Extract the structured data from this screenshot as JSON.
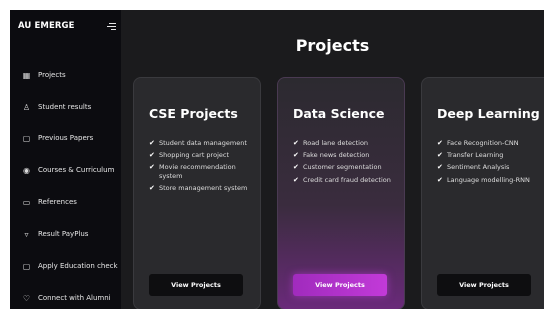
{
  "sidebar": {
    "brand": "AU EMERGE",
    "items": [
      {
        "label": "Projects",
        "icon": "grid-icon",
        "glyph": "▦"
      },
      {
        "label": "Student results",
        "icon": "user-icon",
        "glyph": "♙"
      },
      {
        "label": "Previous Papers",
        "icon": "document-icon",
        "glyph": "▢"
      },
      {
        "label": "Courses & Curriculum",
        "icon": "book-icon",
        "glyph": "◉"
      },
      {
        "label": "References",
        "icon": "folder-icon",
        "glyph": "▭"
      },
      {
        "label": "Result PayPlus",
        "icon": "wallet-icon",
        "glyph": "▿"
      },
      {
        "label": "Apply Education check",
        "icon": "checklist-icon",
        "glyph": "▢"
      },
      {
        "label": "Connect with Alumni",
        "icon": "heart-icon",
        "glyph": "♡"
      }
    ]
  },
  "main": {
    "title": "Projects",
    "cards": [
      {
        "title": "CSE Projects",
        "items": [
          "Student data management",
          "Shopping cart project",
          "Movie recommendation system",
          "Store management system"
        ],
        "button": "View Projects"
      },
      {
        "title": "Data Science",
        "items": [
          "Road lane detection",
          "Fake news detection",
          "Customer segmentation",
          "Credit card fraud detection"
        ],
        "button": "View Projects"
      },
      {
        "title": "Deep Learning",
        "items": [
          "Face Recognition-CNN",
          "Transfer Learning",
          "Sentiment Analysis",
          "Language modelling-RNN"
        ],
        "button": "View Projects"
      }
    ]
  },
  "colors": {
    "background": "#1b1b1d",
    "sidebar": "#0c0c10",
    "card": "#2a2a2d",
    "accent": "#b533cc"
  }
}
